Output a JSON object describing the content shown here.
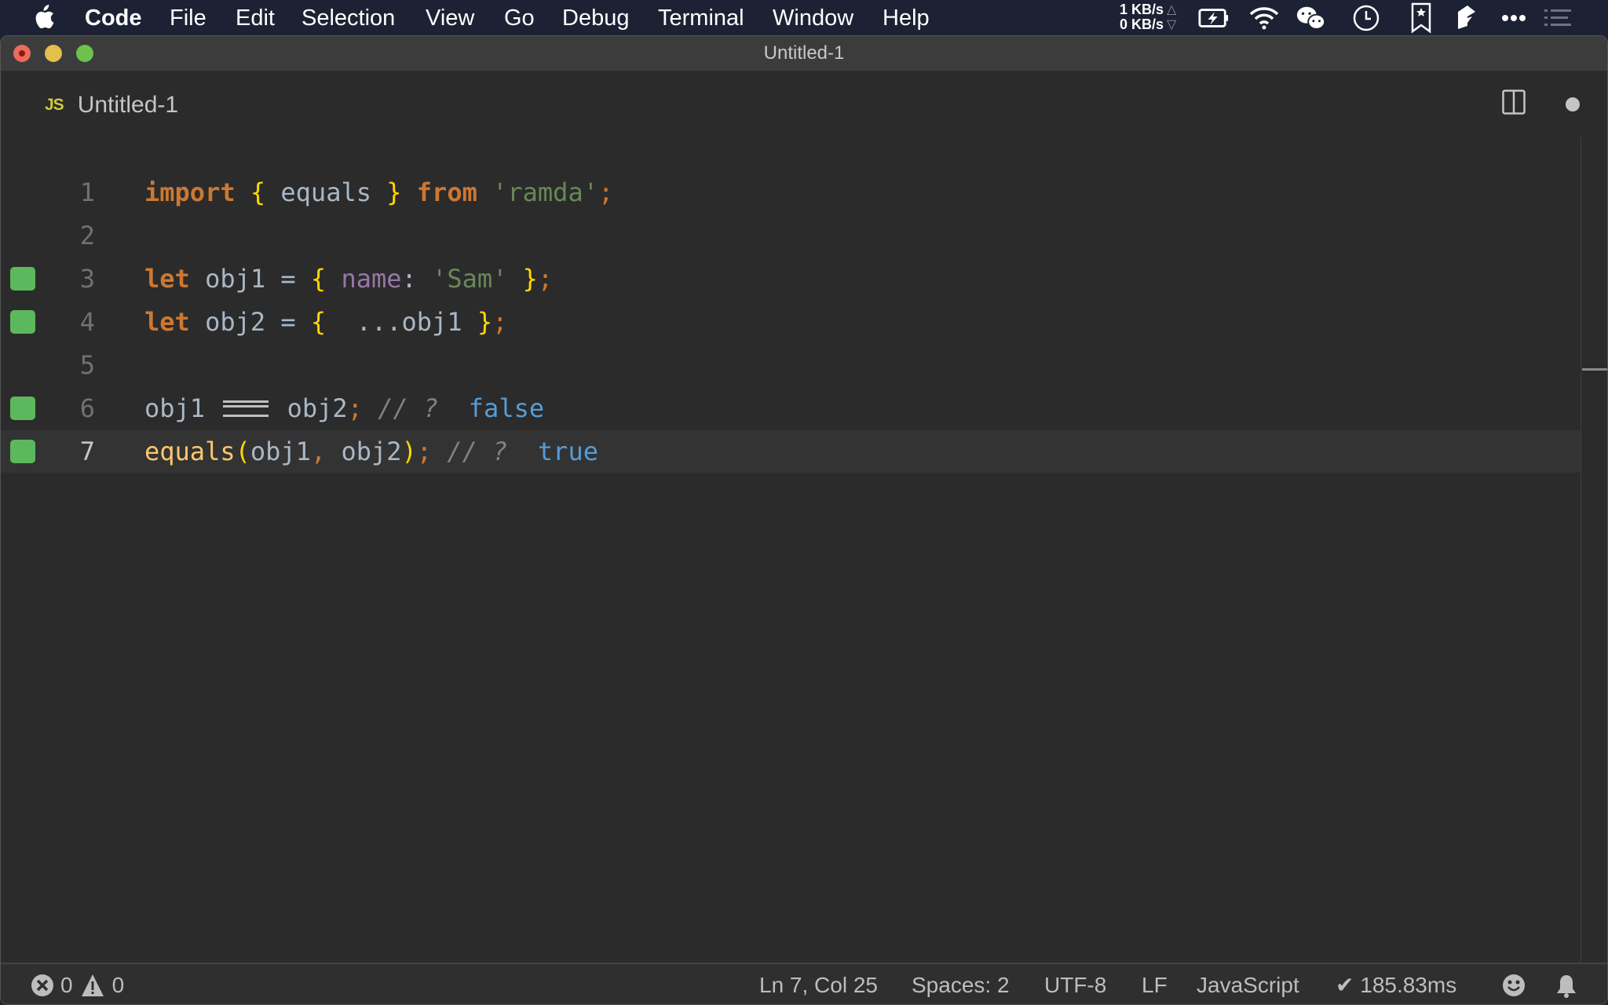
{
  "menubar": {
    "app_name": "Code",
    "items": [
      "File",
      "Edit",
      "Selection",
      "View",
      "Go",
      "Debug",
      "Terminal",
      "Window",
      "Help"
    ],
    "net_up": "1 KB/s",
    "net_down": "0 KB/s",
    "tray_icons": [
      "battery-charging-icon",
      "wifi-icon",
      "wechat-icon",
      "clock-icon",
      "bookmark-star-icon",
      "app-cube-icon",
      "more-dots-icon",
      "list-icon"
    ]
  },
  "window": {
    "title": "Untitled-1"
  },
  "tabs": [
    {
      "icon_text": "JS",
      "label": "Untitled-1",
      "dirty": true
    }
  ],
  "editor": {
    "lines": [
      {
        "number": "1",
        "has_marker": false,
        "current": false
      },
      {
        "number": "2",
        "has_marker": false,
        "current": false
      },
      {
        "number": "3",
        "has_marker": true,
        "current": false
      },
      {
        "number": "4",
        "has_marker": true,
        "current": false
      },
      {
        "number": "5",
        "has_marker": false,
        "current": false
      },
      {
        "number": "6",
        "has_marker": true,
        "current": false
      },
      {
        "number": "7",
        "has_marker": true,
        "current": true
      }
    ],
    "tokens": {
      "l1": [
        "import",
        "{",
        "equals",
        "}",
        "from",
        "'ramda'",
        ";"
      ],
      "l3": [
        "let",
        "obj1",
        "=",
        "{",
        "name",
        ":",
        "'Sam'",
        "}",
        ";"
      ],
      "l4": [
        "let",
        "obj2",
        "=",
        "{",
        "...",
        "obj1",
        "}",
        ";"
      ],
      "l6": [
        "obj1",
        "obj2",
        ";",
        "// ?",
        "false"
      ],
      "l7": [
        "equals",
        "(",
        "obj1",
        ",",
        "obj2",
        ")",
        ";",
        "// ?",
        "true"
      ]
    },
    "marker_color": "#5cb85c"
  },
  "statusbar": {
    "errors": "0",
    "warnings": "0",
    "cursor": "Ln 7, Col 25",
    "indent": "Spaces: 2",
    "encoding": "UTF-8",
    "eol": "LF",
    "language": "JavaScript",
    "timing": "✔ 185.83ms"
  }
}
